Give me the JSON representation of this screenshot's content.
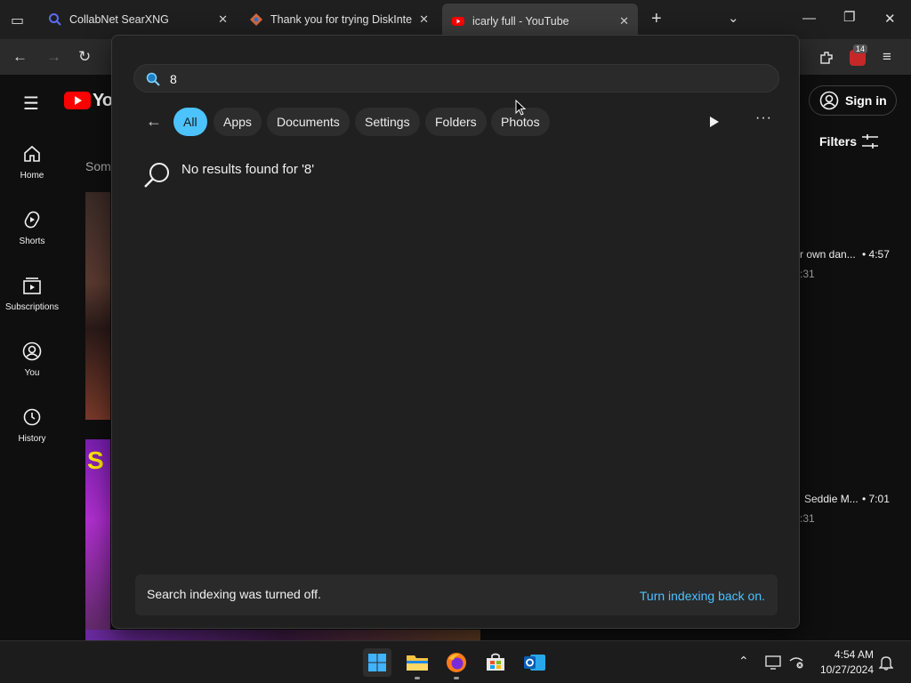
{
  "browser": {
    "tabs": [
      {
        "label": "CollabNet SearXNG",
        "icon": "search-icon"
      },
      {
        "label": "Thank you for trying DiskInternals",
        "icon": "diskinternals-icon"
      },
      {
        "label": "icarly full - YouTube",
        "icon": "youtube-icon"
      }
    ],
    "new_tab_symbol": "+",
    "extension_badge": "14"
  },
  "youtube": {
    "logo_text": "You",
    "sign_in_label": "Sign in",
    "filters_label": "Filters",
    "partial_heading": "Som",
    "nav": [
      {
        "label": "Home",
        "icon": "home-icon"
      },
      {
        "label": "Shorts",
        "icon": "shorts-icon"
      },
      {
        "label": "Subscriptions",
        "icon": "subscriptions-icon"
      },
      {
        "label": "You",
        "icon": "user-icon"
      },
      {
        "label": "History",
        "icon": "history-icon"
      }
    ],
    "right_snippets": [
      {
        "title": "r own dan...",
        "duration": "• 4:57",
        "sub": ":31"
      },
      {
        "title": "Seddie M...",
        "duration": "• 7:01",
        "sub": ":31"
      }
    ]
  },
  "search": {
    "query": "8",
    "filters": [
      "All",
      "Apps",
      "Documents",
      "Settings",
      "Folders",
      "Photos"
    ],
    "active_filter": "All",
    "no_results": "No results found for '8'",
    "indexing_message": "Search indexing was turned off.",
    "indexing_link": "Turn indexing back on."
  },
  "taskbar": {
    "time": "4:54 AM",
    "date": "10/27/2024"
  },
  "colors": {
    "accent": "#4cc2ff",
    "youtube_red": "#ff0000",
    "panel_bg": "#202020"
  }
}
